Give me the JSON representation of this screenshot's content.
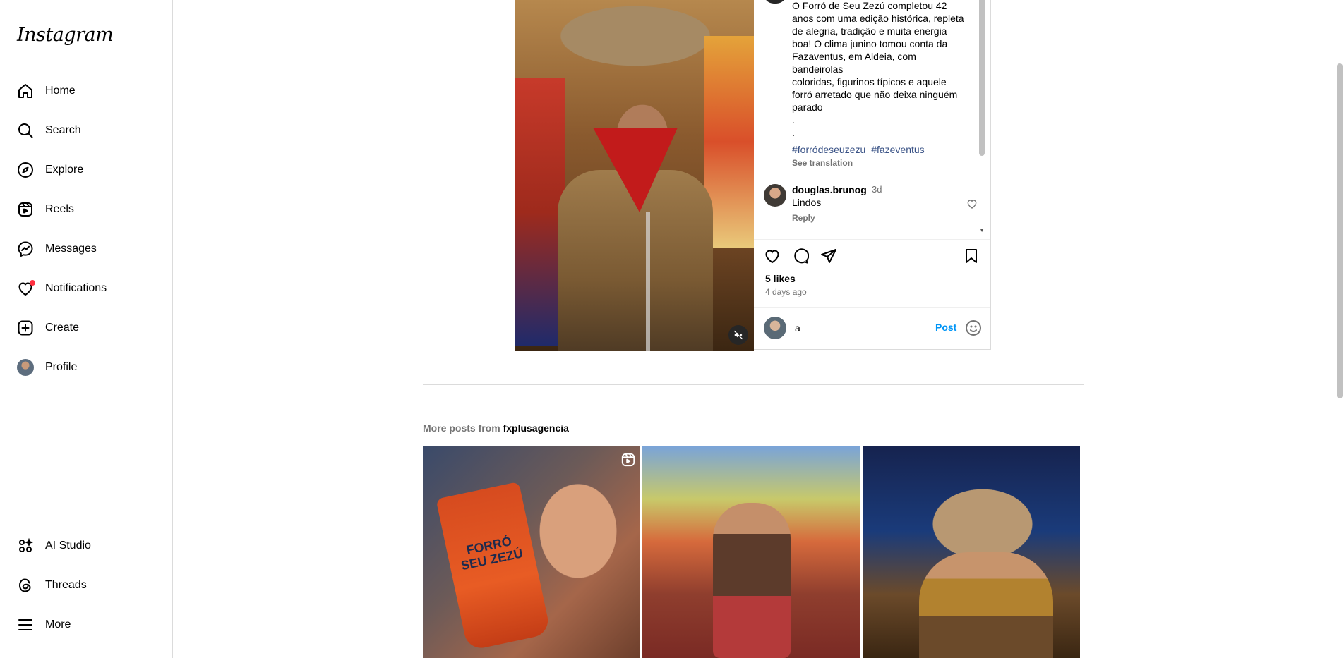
{
  "app": {
    "logo": "Instagram"
  },
  "sidebar": {
    "items": [
      {
        "label": "Home",
        "icon": "home-icon"
      },
      {
        "label": "Search",
        "icon": "search-icon"
      },
      {
        "label": "Explore",
        "icon": "compass-icon"
      },
      {
        "label": "Reels",
        "icon": "reels-icon"
      },
      {
        "label": "Messages",
        "icon": "messenger-icon"
      },
      {
        "label": "Notifications",
        "icon": "heart-icon"
      },
      {
        "label": "Create",
        "icon": "plus-square-icon"
      },
      {
        "label": "Profile",
        "icon": "avatar"
      }
    ],
    "bottom_items": [
      {
        "label": "AI Studio",
        "icon": "ai-studio-icon"
      },
      {
        "label": "Threads",
        "icon": "threads-icon"
      },
      {
        "label": "More",
        "icon": "menu-icon"
      }
    ],
    "notification_dot_color": "#ff3040"
  },
  "post": {
    "caption_lines": [
      "O Forró de Seu Zezú completou 42",
      "anos com uma edição histórica, repleta",
      "de alegria, tradição e muita energia",
      "boa! O clima junino tomou conta da",
      "Fazaventus, em Aldeia, com bandeirolas",
      "coloridas, figurinos típicos e aquele",
      "forró arretado que não deixa ninguém",
      "parado"
    ],
    "caption_dots": [
      ".",
      ".",
      ".",
      "."
    ],
    "hashtags": [
      "#forródeseuzezu",
      "#fazeventus"
    ],
    "see_translation": "See translation",
    "comment": {
      "username": "douglas.brunog",
      "time": "3d",
      "text": "Lindos",
      "reply": "Reply"
    },
    "likes": "5 likes",
    "posted": "4 days ago",
    "comment_input_value": "a",
    "post_button": "Post",
    "link_color": "#385185",
    "accent_color": "#0095f6"
  },
  "more_posts": {
    "prefix": "More posts from",
    "account": "fxplusagencia",
    "thumb1_cup_text": "FORRÓ SEU ZEZÚ"
  }
}
